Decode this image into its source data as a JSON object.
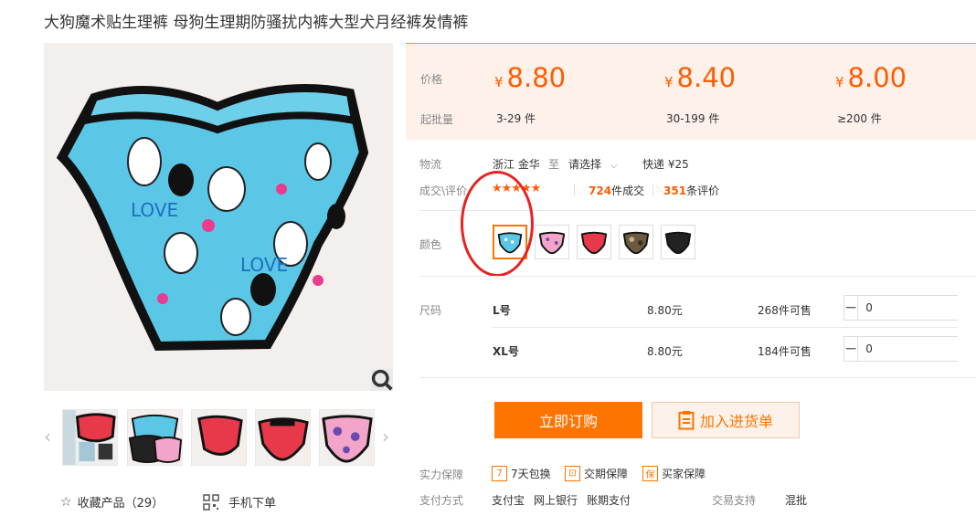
{
  "product": {
    "title": "大狗魔术贴生理裤 母狗生理期防骚扰内裤大型犬月经裤发情裤"
  },
  "price_box": {
    "price_label": "价格",
    "moq_label": "起批量",
    "currency": "¥",
    "tiers": [
      {
        "price": "8.80",
        "range": "3-29 件"
      },
      {
        "price": "8.40",
        "range": "30-199 件"
      },
      {
        "price": "8.00",
        "range": "≥200 件"
      }
    ]
  },
  "logistics": {
    "label": "物流",
    "origin": "浙江 金华",
    "to": "至",
    "destination": "请选择",
    "shipping": "快递 ¥25"
  },
  "deals": {
    "label": "成交\\评价",
    "rating": 4.5,
    "stars": "★★★★★",
    "deal_count": "724",
    "deal_suffix": "件成交",
    "review_count": "351",
    "review_suffix": "条评价"
  },
  "color": {
    "label": "颜色",
    "swatches": [
      {
        "name": "blue-bunny",
        "bg": "#5bc7e6",
        "selected": true
      },
      {
        "name": "pink-print",
        "bg": "#f2a5c8",
        "selected": false
      },
      {
        "name": "red",
        "bg": "#e8394b",
        "selected": false
      },
      {
        "name": "camo",
        "bg": "#6d5a3f",
        "selected": false
      },
      {
        "name": "black",
        "bg": "#222222",
        "selected": false
      }
    ]
  },
  "size": {
    "label": "尺码",
    "rows": [
      {
        "name": "L号",
        "price": "8.80元",
        "stock": "268件可售",
        "qty": "0"
      },
      {
        "name": "XL号",
        "price": "8.80元",
        "stock": "184件可售",
        "qty": "0"
      }
    ]
  },
  "actions": {
    "buy_label": "立即订购",
    "cart_label": "加入进货单"
  },
  "guarantee": {
    "label": "实力保障",
    "items": [
      {
        "icon": "7",
        "text": "7天包换"
      },
      {
        "icon": "⊡",
        "text": "交期保障"
      },
      {
        "icon": "保",
        "text": "买家保障"
      }
    ]
  },
  "payment": {
    "label": "支付方式",
    "methods": [
      "支付宝",
      "网上银行",
      "账期支付"
    ],
    "trade_label": "交易支持",
    "trade_value": "混批"
  },
  "sidebar": {
    "fav_label": "收藏产品（29）",
    "mobile_label": "手机下单"
  },
  "colors": {
    "accent": "#ff7300",
    "price": "#ff5c00",
    "price_bg": "#fdf1ea",
    "annotation": "#e62224"
  }
}
